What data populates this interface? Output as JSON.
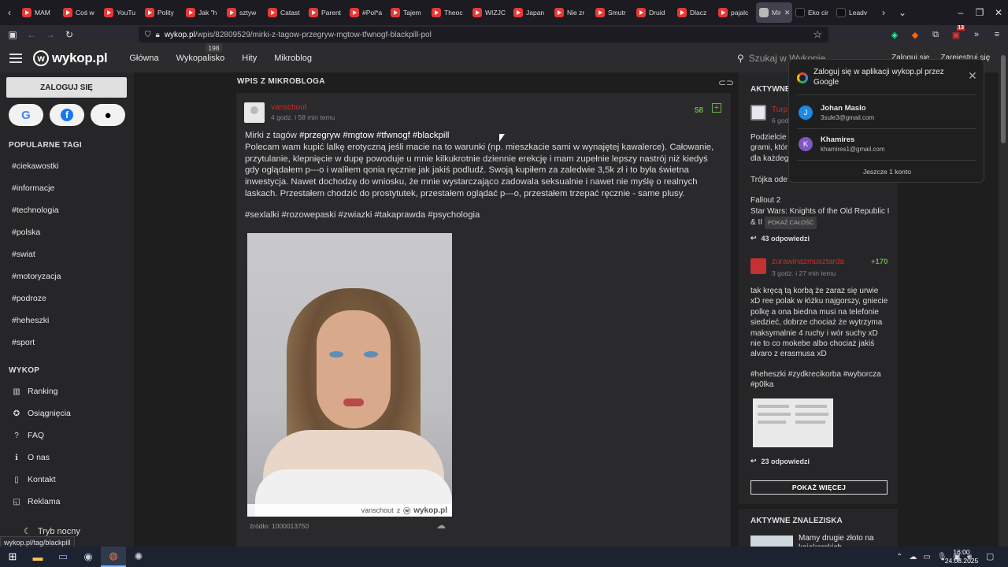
{
  "browser": {
    "tabs": [
      {
        "label": "MAM",
        "icon": "yt"
      },
      {
        "label": "Coś w",
        "icon": "yt"
      },
      {
        "label": "YouTu",
        "icon": "yt"
      },
      {
        "label": "Polity",
        "icon": "yt"
      },
      {
        "label": "Jak \"h",
        "icon": "yt"
      },
      {
        "label": "sztyw",
        "icon": "yt"
      },
      {
        "label": "Catast",
        "icon": "yt"
      },
      {
        "label": "Parent",
        "icon": "yt"
      },
      {
        "label": "#Pol*a",
        "icon": "yt"
      },
      {
        "label": "Tajem",
        "icon": "yt"
      },
      {
        "label": "Theoc",
        "icon": "yt"
      },
      {
        "label": "WIZJC",
        "icon": "yt"
      },
      {
        "label": "Japan",
        "icon": "yt"
      },
      {
        "label": "Nie zr",
        "icon": "yt"
      },
      {
        "label": "Smutr",
        "icon": "yt"
      },
      {
        "label": "Druid",
        "icon": "yt"
      },
      {
        "label": "Dlacz",
        "icon": "yt"
      },
      {
        "label": "pajalc",
        "icon": "yt"
      },
      {
        "label": "Mir",
        "icon": "wk",
        "active": true
      },
      {
        "label": "Eko cir",
        "icon": "tt"
      },
      {
        "label": "Leadv",
        "icon": "tt"
      }
    ],
    "url_host": "wykop.pl",
    "url_path": "/wpis/82809529/mirki-z-tagow-przegryw-mgtow-tfwnogf-blackpill-pol",
    "ext_badge": "13",
    "status_link": "wykop.pl/tag/blackpill"
  },
  "header": {
    "logo": "wykop.pl",
    "nav": [
      "Główna",
      "Wykopalisko",
      "Hity",
      "Mikroblog"
    ],
    "wykopalisko_badge": "198",
    "search_placeholder": "Szukaj w Wykopie",
    "login": "Zaloguj się",
    "register": "Zarejestruj się"
  },
  "sidebar": {
    "login_button": "ZALOGUJ SIĘ",
    "popular_title": "POPULARNE TAGI",
    "tags": [
      "#ciekawostki",
      "#informacje",
      "#technologia",
      "#polska",
      "#swiat",
      "#motoryzacja",
      "#podroze",
      "#heheszki",
      "#sport"
    ],
    "wykop_title": "WYKOP",
    "links": [
      {
        "label": "Ranking",
        "icon": "ranking-icon",
        "glyph": "▥"
      },
      {
        "label": "Osiągnięcia",
        "icon": "achievement-icon",
        "glyph": "✪"
      },
      {
        "label": "FAQ",
        "icon": "faq-icon",
        "glyph": "?"
      },
      {
        "label": "O nas",
        "icon": "info-icon",
        "glyph": "ℹ"
      },
      {
        "label": "Kontakt",
        "icon": "phone-icon",
        "glyph": "▯"
      },
      {
        "label": "Reklama",
        "icon": "megaphone-icon",
        "glyph": "◱"
      }
    ],
    "night_mode": "Tryb nocny"
  },
  "main": {
    "section_title": "WPIS Z MIKROBLOGA",
    "post": {
      "author": "vanschout",
      "time": "4 godz. i 58 min temu",
      "votes": "58",
      "intro": "Mirki z tagów",
      "intro_tags": [
        "#przegryw",
        "#mgtow",
        "#tfwnogf",
        "#blackpill"
      ],
      "body_lines": [
        "Polecam wam kupić lalkę erotyczną jeśli macie na to warunki (np. mieszkacie sami w wynajętej kawalerce). Całowanie,",
        "przytulanie, klepnięcie w dupę powoduje u mnie kilkukrotnie dziennie erekcję i mam zupełnie lepszy nastrój niż kiedyś",
        "gdy oglądałem p---o i waliłem qonia ręcznie jak jakiś podludź. Swoją kupiłem za zaledwie 3,5k zł i to była świetna",
        "inwestycja. Nawet dochodzę do wniosku, że mnie wystarczająco zadowala seksualnie i nawet nie myślę o realnych",
        "laskach. Przestałem chodzić do prostytutek, przestałem oglądać p---o, przestałem trzepać ręcznie - same plusy."
      ],
      "tags": "#sexlalki #rozowepaski #zwiazki #takaprawda #psychologia",
      "watermark_user": "vanschout",
      "watermark_z": "z",
      "watermark_site": "wykop.pl",
      "source": "źródło: 1000013750"
    }
  },
  "right": {
    "title": "AKTYWNE WPISY",
    "entry1": {
      "author": "Turp",
      "time": "6 godz.",
      "text_lines": [
        "Podzielcie",
        "grami, któr",
        "dla każdeg",
        "",
        "Trójka ode",
        "",
        "Fallout 2",
        "Star Wars: Knights of the Old Republic I",
        "& II"
      ],
      "show_all": "POKAŻ CAŁOŚĆ",
      "replies": "43 odpowiedzi"
    },
    "entry2": {
      "author": "zurawinazmusztarda",
      "time": "3 godz. i 27 min temu",
      "votes": "+170",
      "text_lines": [
        "tak kręcą tą korbą że zaraz się urwie",
        "xD ree polak w łóżku najgorszy, gniecie",
        "polkę a ona biedna musi na telefonie",
        "siedzieć, dobrze chociaż że wytrzyma",
        "maksymalnie 4 ruchy i wór suchy xD",
        "nie to co mokebe albo chociaż jakiś",
        "alvaro z erasmusa xD"
      ],
      "tags_lines": [
        "#heheszki #zydkrecikorba #wyborcza",
        "#p0lka"
      ],
      "replies": "23 odpowiedzi"
    },
    "more_button": "POKAŻ WIĘCEJ",
    "findings_title": "AKTYWNE ZNALEZISKA",
    "finding_text": "Mamy drugie złoto na",
    "finding_text2": "kajakarskich"
  },
  "popup": {
    "title": "Zaloguj się w aplikacji wykop.pl przez Google",
    "accounts": [
      {
        "initial": "J",
        "name": "Johan Maslo",
        "email": "3sule3@gmail.com",
        "color": "#1e88e5"
      },
      {
        "initial": "K",
        "name": "Khamires",
        "email": "khamires1@gmail.com",
        "color": "#7e57c2"
      }
    ],
    "more": "Jeszcze 1 konto"
  },
  "taskbar": {
    "time": "16:00",
    "date": "24.08.2025"
  },
  "colors": {
    "accent": "#c53030",
    "vote": "#6ab04c",
    "bg": "#1e1e1f",
    "card": "#2a2a2c"
  }
}
